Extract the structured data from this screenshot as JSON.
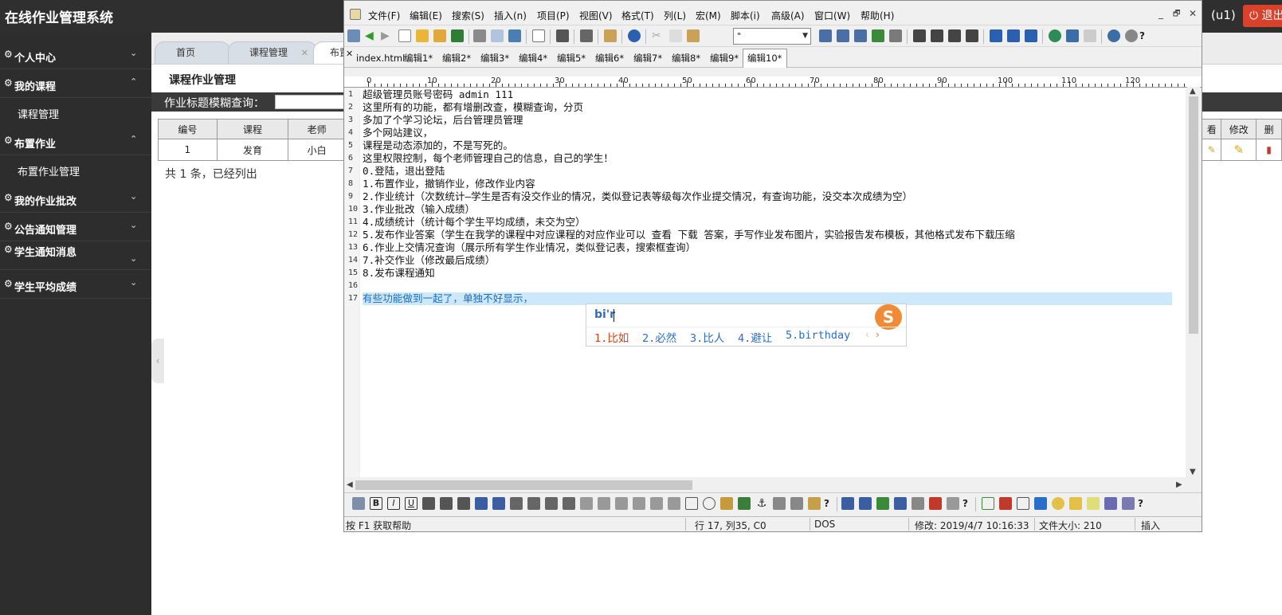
{
  "system": {
    "title": "在线作业管理系统",
    "user": "(u1)",
    "logout_label": "⏻ 退出"
  },
  "sidebar": {
    "items": [
      {
        "label": "个人中心"
      },
      {
        "label": "我的课程",
        "sub": "课程管理"
      },
      {
        "label": "布置作业",
        "sub": "布置作业管理"
      },
      {
        "label": "我的作业批改"
      },
      {
        "label": "公告通知管理"
      },
      {
        "label": "学生通知消息"
      },
      {
        "label": "学生平均成绩"
      }
    ]
  },
  "app_tabs": [
    {
      "label": "首页"
    },
    {
      "label": "课程管理"
    },
    {
      "label": "布置"
    }
  ],
  "page": {
    "title": "课程作业管理",
    "search_label": "作业标题模糊查询：",
    "table": {
      "headers": [
        "编号",
        "课程",
        "老师",
        "看",
        "修改",
        "删"
      ],
      "row": [
        "1",
        "发育",
        "小白"
      ]
    },
    "count_text": "共 1 条，已经列出"
  },
  "editor": {
    "menus": [
      "文件(F)",
      "编辑(E)",
      "搜索(S)",
      "插入(n)",
      "项目(P)",
      "视图(V)",
      "格式(T)",
      "列(L)",
      "宏(M)",
      "脚本(i)",
      "高级(A)",
      "窗口(W)",
      "帮助(H)"
    ],
    "window_controls": [
      "_",
      "🗗",
      "✕"
    ],
    "help_mark": "?",
    "font_combo": "\"",
    "doc_tabs": [
      "index.html",
      "编辑1*",
      "编辑2*",
      "编辑3*",
      "编辑4*",
      "编辑5*",
      "编辑6*",
      "编辑7*",
      "编辑8*",
      "编辑9*",
      "编辑10*"
    ],
    "ruler_labels": [
      "0",
      "10",
      "20",
      "30",
      "40",
      "50",
      "60",
      "70",
      "80",
      "90",
      "100",
      "110",
      "120"
    ],
    "lines": [
      "超级管理员账号密码 admin 111",
      "这里所有的功能，都有增删改查，模糊查询，分页",
      "多加了个学习论坛，后台管理员管理",
      "多个网站建议，",
      "课程是动态添加的，不是写死的。",
      "这里权限控制，每个老师管理自己的信息，自己的学生！",
      "0.登陆，退出登陆",
      "1.布置作业，撤销作业，修改作业内容",
      "2.作业统计（次数统计—学生是否有没交作业的情况，类似登记表等级每次作业提交情况，有查询功能，没交本次成绩为空）",
      "3.作业批改（输入成绩）",
      "4.成绩统计（统计每个学生平均成绩，未交为空）",
      "5.发布作业答案（学生在我学的课程中对应课程的对应作业可以 查看 下载 答案，手写作业发布图片，实验报告发布模板，其他格式发布下载压缩",
      "6.作业上交情况查询（展示所有学生作业情况，类似登记表，搜索框查询）",
      "7.补交作业（修改最后成绩）",
      "8.发布课程通知",
      "",
      "有些功能做到一起了，单独不好显示，"
    ],
    "status": {
      "help": "按 F1 获取帮助",
      "position": "行 17, 列35, C0",
      "format": "DOS",
      "modified": "修改: 2019/4/7 10:16:33",
      "size": "文件大小: 210",
      "mode": "插入"
    }
  },
  "ime": {
    "input": "bi'r",
    "logo": "S",
    "candidates": [
      "1.比如",
      "2.必然",
      "3.比人",
      "4.避让",
      "5.birthday"
    ],
    "prev": "‹",
    "next": "›"
  }
}
